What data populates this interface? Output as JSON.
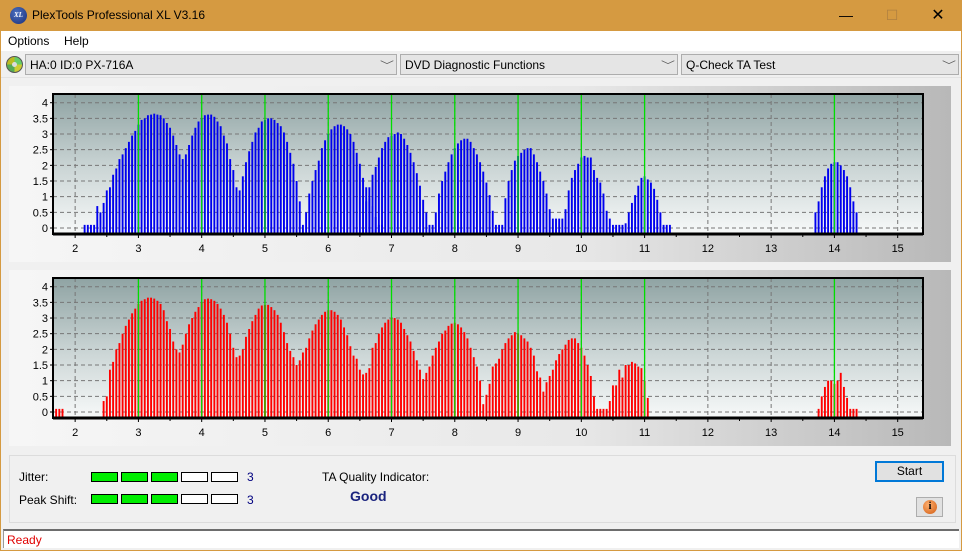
{
  "window": {
    "title": "PlexTools Professional XL V3.16",
    "app_icon": "XL",
    "controls": {
      "minimize": "—",
      "maximize": "☐",
      "close": "✕"
    }
  },
  "menu": [
    "Options",
    "Help"
  ],
  "toolbar": {
    "drive": "HA:0 ID:0  PX-716A",
    "function": "DVD Diagnostic Functions",
    "test": "Q-Check TA Test",
    "arrow": "﹀"
  },
  "colors": {
    "jitter_bars": "#0000ee",
    "peak_bars": "#ff0000",
    "marker_lines": "#00dd00",
    "meter_on": "#00ee00",
    "status_text": "#e00000"
  },
  "chart_data": [
    {
      "type": "bar",
      "name": "ta-jitter-chart",
      "series_color": "#0000ee",
      "xlim": [
        1.65,
        15.4
      ],
      "ylim": [
        0,
        4.15
      ],
      "yticks": [
        "0",
        "0.5",
        "1",
        "1.5",
        "2",
        "2.5",
        "3",
        "3.5",
        "4"
      ],
      "xticks": [
        "2",
        "3",
        "4",
        "5",
        "6",
        "7",
        "8",
        "9",
        "10",
        "11",
        "12",
        "13",
        "14",
        "15"
      ],
      "markers": [
        3,
        4,
        5,
        6,
        7,
        8,
        9,
        10,
        11,
        14
      ],
      "grid": true,
      "bar_step": 0.05,
      "clusters": [
        {
          "start": 2.15,
          "values": [
            0,
            0,
            0,
            0,
            0.7,
            0.5,
            0.8,
            1.2,
            1.3,
            1.7,
            1.9,
            2.2,
            2.35,
            2.55,
            2.75,
            2.95,
            3.1,
            3.3,
            3.45,
            3.5,
            3.6,
            3.62,
            3.65,
            3.62,
            3.6,
            3.5,
            3.35,
            3.2,
            2.95,
            2.65,
            2.35,
            2.2,
            2.35,
            2.65,
            2.95,
            3.2,
            3.4,
            3.5,
            3.6,
            3.62,
            3.62,
            3.55,
            3.4,
            3.25,
            2.95,
            2.7,
            2.2,
            1.85,
            1.3,
            1.2,
            1.65,
            2.1,
            2.45,
            2.75,
            3.05,
            3.2,
            3.4,
            3.45,
            3.5,
            3.5,
            3.45,
            3.35,
            3.25,
            3.05,
            2.75,
            2.4,
            2.05,
            1.5,
            0.85,
            0,
            0.5,
            1.1,
            1.5,
            1.85,
            2.15,
            2.55,
            2.8,
            3.0,
            3.15,
            3.25,
            3.3,
            3.3,
            3.25,
            3.15,
            3.0,
            2.75,
            2.4,
            2.05,
            1.6,
            1.3,
            0.95,
            0.7,
            0.35,
            0.0,
            0.0
          ]
        },
        {
          "start": 6.6,
          "values": [
            0.85,
            1.3,
            1.7,
            1.95,
            2.25,
            2.55,
            2.75,
            2.9,
            2.95,
            3.0,
            3.05,
            3.0,
            2.85,
            2.65,
            2.4,
            2.1,
            1.75,
            1.35,
            0.9,
            0.5,
            0,
            0,
            0.5,
            1.1,
            1.5,
            1.8,
            2.1,
            2.35,
            2.55,
            2.7,
            2.8,
            2.85,
            2.85,
            2.75,
            2.55,
            2.35,
            2.1,
            1.8,
            1.45,
            1.05,
            0.55,
            0,
            0,
            0,
            0.95,
            1.5,
            1.85,
            2.15,
            2.3,
            2.4,
            2.5,
            2.55,
            2.55,
            2.35,
            2.1,
            1.8,
            1.5,
            1.1,
            0.6,
            0.3,
            0.3,
            0.3,
            0.3,
            0.6,
            1.2,
            1.6,
            1.85,
            2.05,
            2.25,
            2.3,
            2.25,
            2.25,
            1.85,
            1.6,
            1.45,
            1.1,
            0.55,
            0.3,
            0,
            0,
            0,
            0,
            0.15,
            0.5,
            0.8,
            1.05,
            1.35,
            1.6,
            1.65,
            1.55,
            1.45,
            1.25,
            0.9,
            0.5,
            0,
            0.1,
            0.1
          ]
        },
        {
          "start": 13.7,
          "values": [
            0.5,
            0.85,
            1.3,
            1.65,
            1.9,
            2.05,
            2.1,
            2.1,
            2.0,
            1.85,
            1.65,
            1.3,
            0.85,
            0.5
          ]
        }
      ]
    },
    {
      "type": "bar",
      "name": "ta-peak-shift-chart",
      "series_color": "#ff0000",
      "xlim": [
        1.65,
        15.4
      ],
      "ylim": [
        0,
        4.15
      ],
      "yticks": [
        "0",
        "0.5",
        "1",
        "1.5",
        "2",
        "2.5",
        "3",
        "3.5",
        "4"
      ],
      "xticks": [
        "2",
        "3",
        "4",
        "5",
        "6",
        "7",
        "8",
        "9",
        "10",
        "11",
        "12",
        "13",
        "14",
        "15"
      ],
      "markers": [
        3,
        4,
        5,
        6,
        7,
        8,
        9,
        10,
        11,
        14
      ],
      "grid": true,
      "bar_step": 0.05,
      "clusters": [
        {
          "start": 1.7,
          "values": [
            0.1,
            0,
            0.1
          ]
        },
        {
          "start": 2.45,
          "values": [
            0.35,
            0.5,
            1.35,
            1.6,
            2.0,
            2.2,
            2.5,
            2.75,
            2.95,
            3.15,
            3.3,
            3.45,
            3.55,
            3.6,
            3.65,
            3.65,
            3.62,
            3.55,
            3.45,
            3.25,
            2.9,
            2.65,
            2.25,
            2.0,
            1.9,
            2.15,
            2.5,
            2.8,
            3.0,
            3.2,
            3.35,
            3.5,
            3.6,
            3.62,
            3.6,
            3.55,
            3.45,
            3.3,
            3.1,
            2.85,
            2.5,
            2.05,
            1.75,
            1.8,
            2.0,
            2.4,
            2.65,
            2.9,
            3.1,
            3.3,
            3.4,
            3.42,
            3.42,
            3.35,
            3.25,
            3.1,
            2.85,
            2.55,
            2.2,
            1.95,
            1.75,
            1.5,
            1.65,
            1.9,
            2.05,
            2.35,
            2.6,
            2.8,
            2.95,
            3.1,
            3.2,
            3.25,
            3.25,
            3.2,
            3.1,
            2.95,
            2.7,
            2.45,
            2.1,
            1.8,
            1.7,
            1.35,
            1.2,
            1.25,
            1.4,
            2.05,
            2.2,
            2.5,
            2.7,
            2.85,
            2.95,
            3.0,
            3.0,
            2.95,
            2.85,
            2.65,
            2.45,
            2.25,
            1.95,
            1.65,
            1.35,
            1.05,
            1.25,
            1.45,
            1.8,
            2.05,
            2.25,
            2.5,
            2.6,
            2.75,
            2.82,
            2.85,
            2.8,
            2.7,
            2.55,
            2.35,
            2.05,
            1.75,
            1.45,
            1.0,
            0.25,
            0.55,
            0.9,
            1.45,
            1.55,
            1.7,
            2.0,
            2.2,
            2.35,
            2.45,
            2.55,
            2.5,
            2.45,
            2.35,
            2.25,
            2.05,
            1.8,
            1.3,
            1.1,
            0.65,
            0.95,
            1.15,
            1.35,
            1.65,
            1.85,
            2.0,
            2.15,
            2.3,
            2.35,
            2.35,
            2.2,
            2.05,
            1.8,
            1.5,
            1.15,
            0.5,
            0.1,
            0,
            0,
            0,
            0.35,
            0.85,
            0.85,
            1.35,
            1.1,
            1.5,
            1.5,
            1.6,
            1.55,
            1.45,
            1.4,
            1.0,
            0.45
          ]
        },
        {
          "start": 13.75,
          "values": [
            0.1,
            0.5,
            0.8,
            1.0,
            1.0,
            0.9,
            1.0,
            1.25,
            0.8,
            0.45,
            0.1,
            0,
            0.1
          ]
        }
      ]
    }
  ],
  "results": {
    "jitter_label": "Jitter:",
    "jitter_level": 3,
    "jitter_value": "3",
    "peak_shift_label": "Peak Shift:",
    "peak_shift_level": 3,
    "peak_shift_value": "3",
    "meter_max": 5,
    "ta_quality_label": "TA Quality Indicator:",
    "ta_quality_value": "Good"
  },
  "buttons": {
    "start": "Start",
    "info_icon": "i"
  },
  "status": "Ready"
}
